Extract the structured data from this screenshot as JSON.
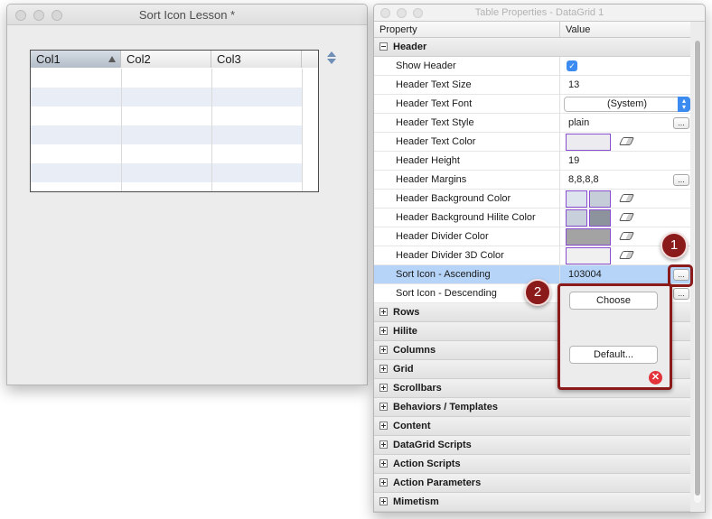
{
  "left_window": {
    "title": "Sort Icon Lesson *"
  },
  "grid": {
    "columns": [
      "Col1",
      "Col2",
      "Col3"
    ]
  },
  "right_window": {
    "title": "Table Properties - DataGrid 1",
    "column_headers": {
      "property": "Property",
      "value": "Value"
    }
  },
  "header_group": {
    "label": "Header"
  },
  "props": {
    "show_header": "Show Header",
    "header_text_size": "Header Text Size",
    "header_text_font": "Header Text Font",
    "header_text_style": "Header Text Style",
    "header_text_color": "Header Text Color",
    "header_height": "Header Height",
    "header_margins": "Header Margins",
    "header_bg_color": "Header Background Color",
    "header_bg_hilite_color": "Header Background Hilite Color",
    "header_divider_color": "Header Divider Color",
    "header_divider_3d_color": "Header Divider 3D Color",
    "sort_icon_ascending": "Sort Icon - Ascending",
    "sort_icon_descending": "Sort Icon - Descending"
  },
  "values": {
    "header_text_size": "13",
    "header_text_font": "(System)",
    "header_text_style": "plain",
    "header_height": "19",
    "header_margins": "8,8,8,8",
    "sort_icon_ascending": "103004"
  },
  "buttons": {
    "ellipsis": "..."
  },
  "groups": [
    "Rows",
    "Hilite",
    "Columns",
    "Grid",
    "Scrollbars",
    "Behaviors / Templates",
    "Content",
    "DataGrid Scripts",
    "Action Scripts",
    "Action Parameters",
    "Mimetism"
  ],
  "popover": {
    "choose": "Choose",
    "default": "Default..."
  },
  "callouts": {
    "one": "1",
    "two": "2"
  },
  "colors": {
    "accent": "#3b8bf0",
    "selection": "#b6d4f8",
    "callout": "#8b1a1a",
    "swatch_border": "#8a4fd0"
  }
}
